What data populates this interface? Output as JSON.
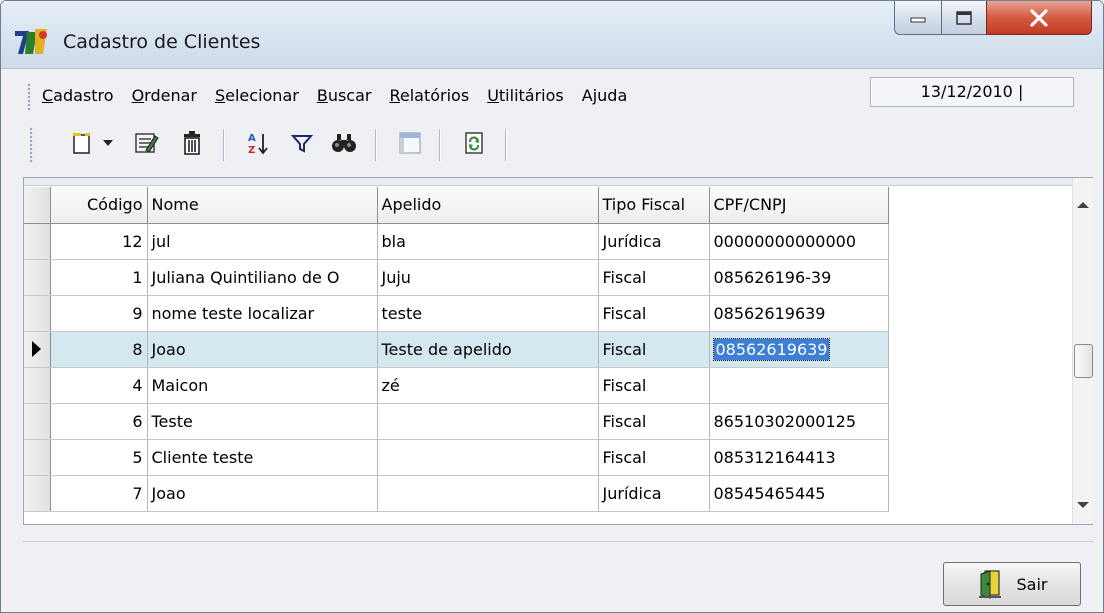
{
  "window": {
    "title": "Cadastro de Clientes"
  },
  "menu": {
    "items": [
      {
        "label": "Cadastro",
        "access": "C"
      },
      {
        "label": "Ordenar",
        "access": "O"
      },
      {
        "label": "Selecionar",
        "access": "S"
      },
      {
        "label": "Buscar",
        "access": "B"
      },
      {
        "label": "Relatórios",
        "access": "R"
      },
      {
        "label": "Utilitários",
        "access": "U"
      },
      {
        "label": "Ajuda",
        "access": "j"
      }
    ]
  },
  "status": {
    "date": "13/12/2010 |"
  },
  "toolbar": {
    "icons": [
      "new-record-icon",
      "dropdown-arrow-icon",
      "edit-record-icon",
      "delete-icon",
      "sort-az-icon",
      "filter-icon",
      "binoculars-icon",
      "grid-view-icon",
      "refresh-icon"
    ]
  },
  "grid": {
    "columns": [
      "Código",
      "Nome",
      "Apelido",
      "Tipo Fiscal",
      "CPF/CNPJ"
    ],
    "selected_index": 3,
    "rows": [
      {
        "codigo": "12",
        "nome": "jul",
        "apelido": "bla",
        "tipo": "Jurídica",
        "doc": "00000000000000"
      },
      {
        "codigo": "1",
        "nome": "Juliana Quintiliano de O",
        "apelido": "Juju",
        "tipo": "Fiscal",
        "doc": "085626196-39"
      },
      {
        "codigo": "9",
        "nome": "nome teste localizar",
        "apelido": "teste",
        "tipo": "Fiscal",
        "doc": "08562619639"
      },
      {
        "codigo": "8",
        "nome": "Joao",
        "apelido": "Teste de apelido",
        "tipo": "Fiscal",
        "doc": "08562619639"
      },
      {
        "codigo": "4",
        "nome": "Maicon",
        "apelido": "zé",
        "tipo": "Fiscal",
        "doc": ""
      },
      {
        "codigo": "6",
        "nome": "Teste",
        "apelido": "",
        "tipo": "Fiscal",
        "doc": "86510302000125"
      },
      {
        "codigo": "5",
        "nome": "Cliente teste",
        "apelido": "",
        "tipo": "Fiscal",
        "doc": "085312164413"
      },
      {
        "codigo": "7",
        "nome": "Joao",
        "apelido": "",
        "tipo": "Jurídica",
        "doc": "08545465445"
      }
    ]
  },
  "footer": {
    "exit_label": "Sair"
  },
  "colors": {
    "selection_row": "#d4e8f0",
    "focus_cell": "#3d7ed6",
    "close_button": "#d25c44"
  }
}
